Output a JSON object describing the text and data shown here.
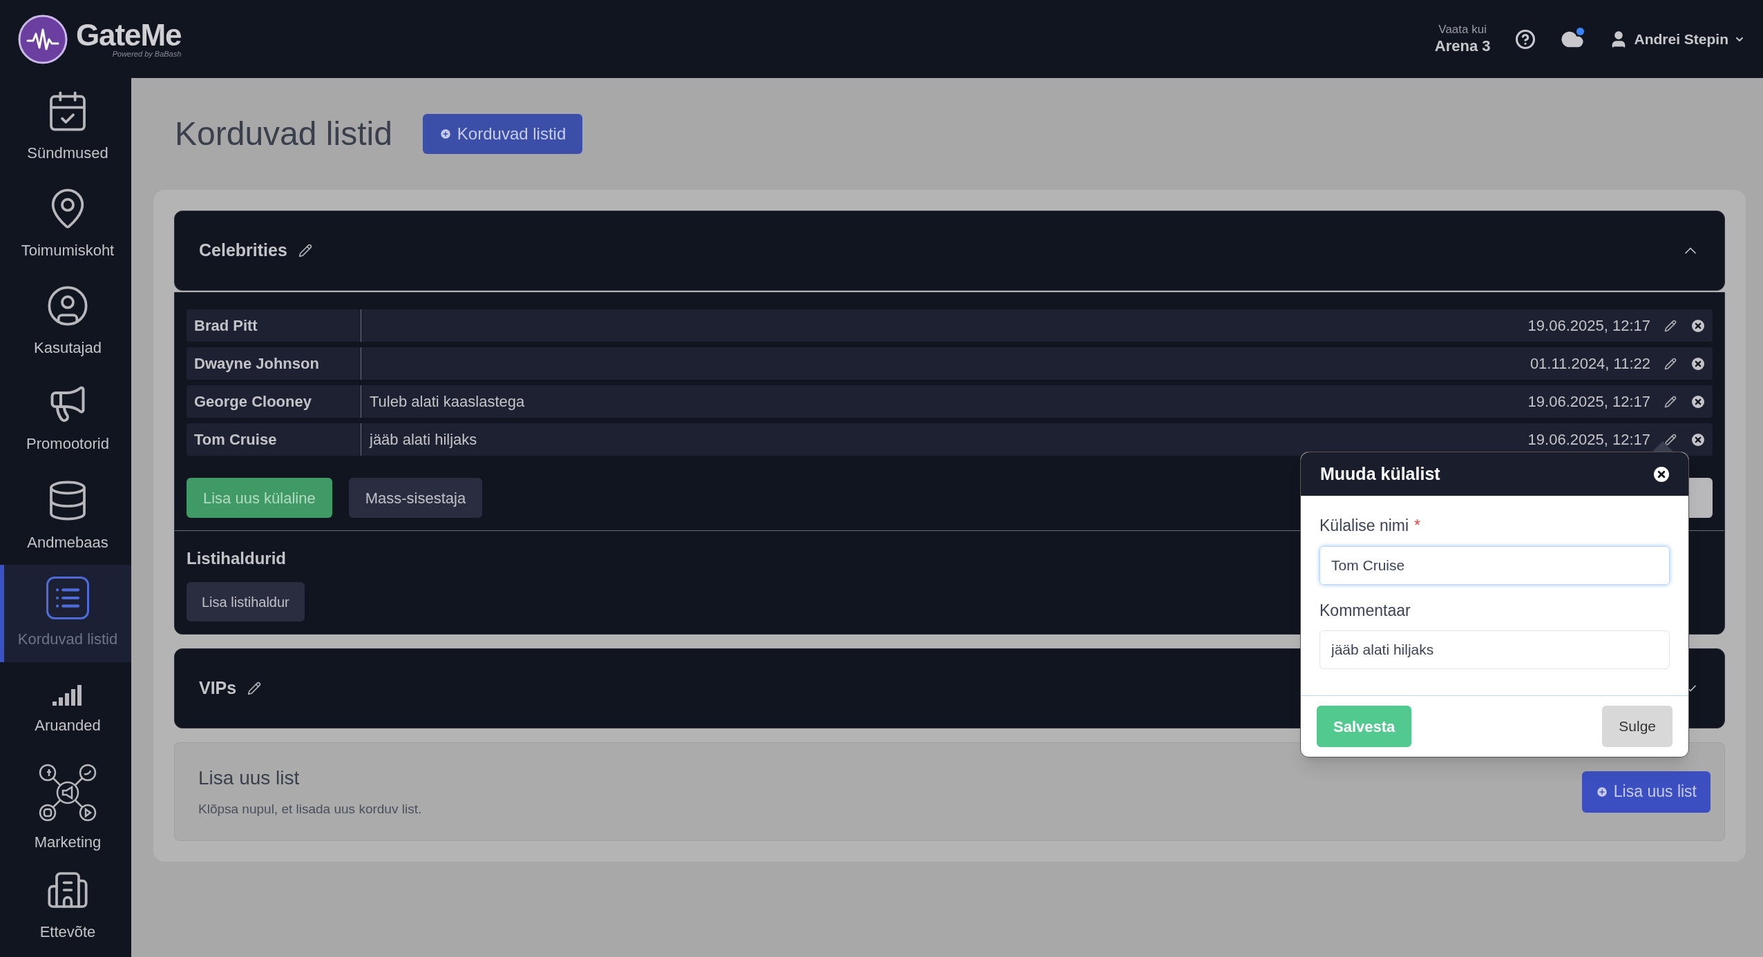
{
  "header": {
    "logo_text": "GateMe",
    "logo_subtitle": "Powered by BaBash",
    "view_as_label": "Vaata kui",
    "view_as_value": "Arena 3",
    "user_name": "Andrei Stepin",
    "notification_dot": true
  },
  "sidebar": {
    "items": [
      {
        "label": "Sündmused",
        "selected": false
      },
      {
        "label": "Toimumiskoht",
        "selected": false
      },
      {
        "label": "Kasutajad",
        "selected": false
      },
      {
        "label": "Promootorid",
        "selected": false
      },
      {
        "label": "Andmebaas",
        "selected": false
      },
      {
        "label": "Korduvad listid",
        "selected": true
      },
      {
        "label": "Aruanded",
        "selected": false
      },
      {
        "label": "Marketing",
        "selected": false
      },
      {
        "label": "Ettevõte",
        "selected": false
      }
    ]
  },
  "page": {
    "title": "Korduvad listid",
    "add_button": "Korduvad listid"
  },
  "lists": [
    {
      "name": "Celebrities",
      "expanded": true,
      "guests": [
        {
          "name": "Brad Pitt",
          "date": "19.06.2025, 12:17"
        },
        {
          "name": "Dwayne Johnson",
          "date": "01.11.2024, 11:22"
        },
        {
          "name": "George Clooney",
          "comment": "Tuleb alati kaaslastega",
          "date": "19.06.2025, 12:17"
        },
        {
          "name": "Tom Cruise",
          "comment": "jääb alati hiljaks",
          "date": "19.06.2025, 12:17"
        }
      ],
      "add_guest_button": "Lisa uus külaline",
      "bulk_button": "Mass-sisestaja",
      "managers_title": "Listihaldurid",
      "add_manager_button": "Lisa listihaldur"
    },
    {
      "name": "VIPs",
      "expanded": false
    }
  ],
  "new_list": {
    "title": "Lisa uus list",
    "description": "Klõpsa nupul, et lisada uus korduv list.",
    "button": "Lisa uus list"
  },
  "popover": {
    "title": "Muuda külalist",
    "name_label": "Külalise nimi",
    "required_mark": "*",
    "name_value": "Tom Cruise",
    "comment_label": "Kommentaar",
    "comment_value": "jääb alati hiljaks",
    "save_button": "Salvesta",
    "close_button": "Sulge"
  }
}
